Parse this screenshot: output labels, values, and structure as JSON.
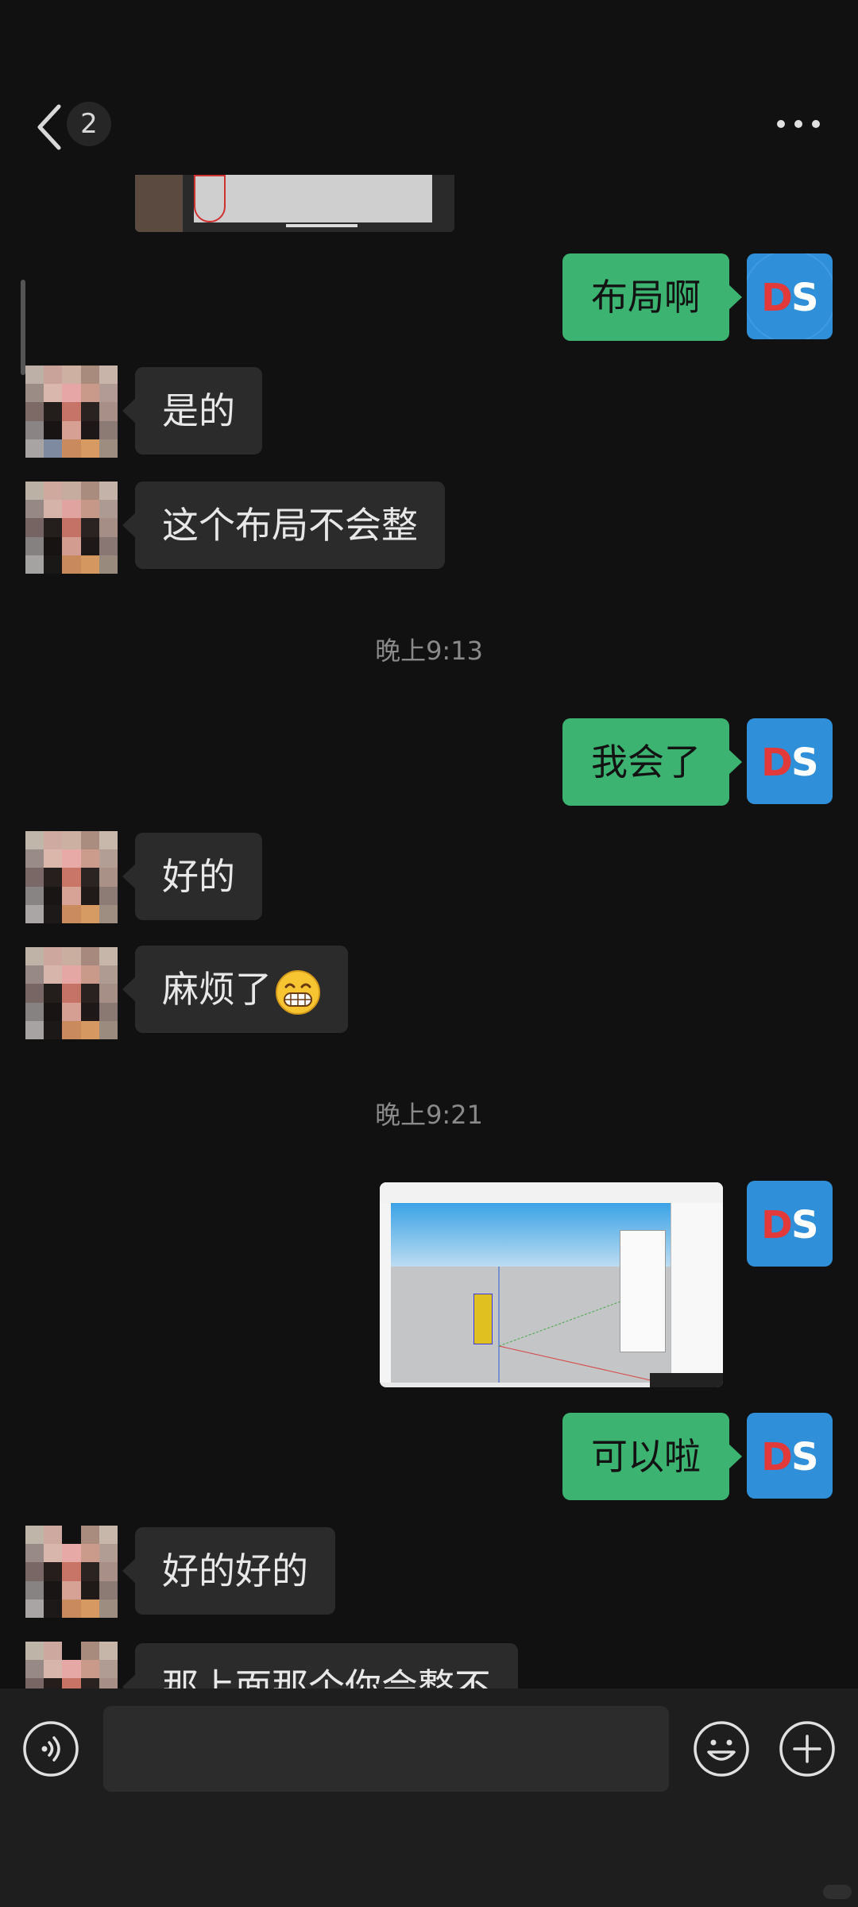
{
  "header": {
    "unread_count": "2"
  },
  "contact_self": {
    "avatar_text_1": "D",
    "avatar_text_2": "S",
    "avatar_color": "#2f8fd8"
  },
  "messages": [
    {
      "side": "out",
      "text": "布局啊"
    },
    {
      "side": "in",
      "text": "是的"
    },
    {
      "side": "in",
      "text": "这个布局不会整"
    },
    {
      "type": "time",
      "text": "晚上9:13"
    },
    {
      "side": "out",
      "text": "我会了"
    },
    {
      "side": "in",
      "text": "好的"
    },
    {
      "side": "in",
      "text": "麻烦了"
    },
    {
      "type": "time",
      "text": "晚上9:21"
    },
    {
      "side": "out",
      "type": "image",
      "icon": "sketchup-screenshot-image"
    },
    {
      "side": "out",
      "text": "可以啦"
    },
    {
      "side": "in",
      "text": "好的好的"
    },
    {
      "side": "in",
      "text": "那上面那个你会整不"
    }
  ],
  "input": {
    "placeholder": ""
  },
  "colors": {
    "background": "#111111",
    "bubble_out": "#3cb371",
    "bubble_in": "#2b2b2b",
    "timestamp": "#8a8a8a"
  }
}
